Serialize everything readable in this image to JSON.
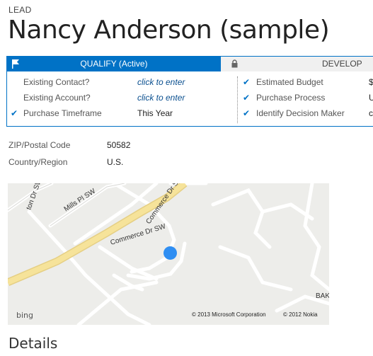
{
  "header": {
    "entity_type": "LEAD",
    "record_name": "Nancy Anderson (sample)"
  },
  "process": {
    "active_stage": "QUALIFY (Active)",
    "next_stage": "DEVELOP",
    "left_steps": [
      {
        "label": "Existing Contact?",
        "value": "click to enter",
        "checked": false
      },
      {
        "label": "Existing Account?",
        "value": "click to enter",
        "checked": false
      },
      {
        "label": "Purchase Timeframe",
        "value": "This Year",
        "checked": true
      }
    ],
    "right_steps": [
      {
        "label": "Estimated Budget",
        "value": "$",
        "checked": true
      },
      {
        "label": "Purchase Process",
        "value": "U",
        "checked": true
      },
      {
        "label": "Identify Decision Maker",
        "value": "c",
        "checked": true
      }
    ]
  },
  "fields": [
    {
      "label": "ZIP/Postal Code",
      "value": "50582"
    },
    {
      "label": "Country/Region",
      "value": "U.S."
    }
  ],
  "map": {
    "streets": [
      "ton Dr SW",
      "Mills Pl SW",
      "Commerce Dr SW",
      "Commerce Dr SW",
      "BAK"
    ],
    "logo": "bing",
    "copyright_1": "© 2013 Microsoft Corporation",
    "copyright_2": "© 2012 Nokia"
  },
  "details": {
    "title": "Details"
  },
  "colors": {
    "accent": "#0072c6",
    "pin": "#2f8ef2",
    "highway": "#f6e39a"
  }
}
